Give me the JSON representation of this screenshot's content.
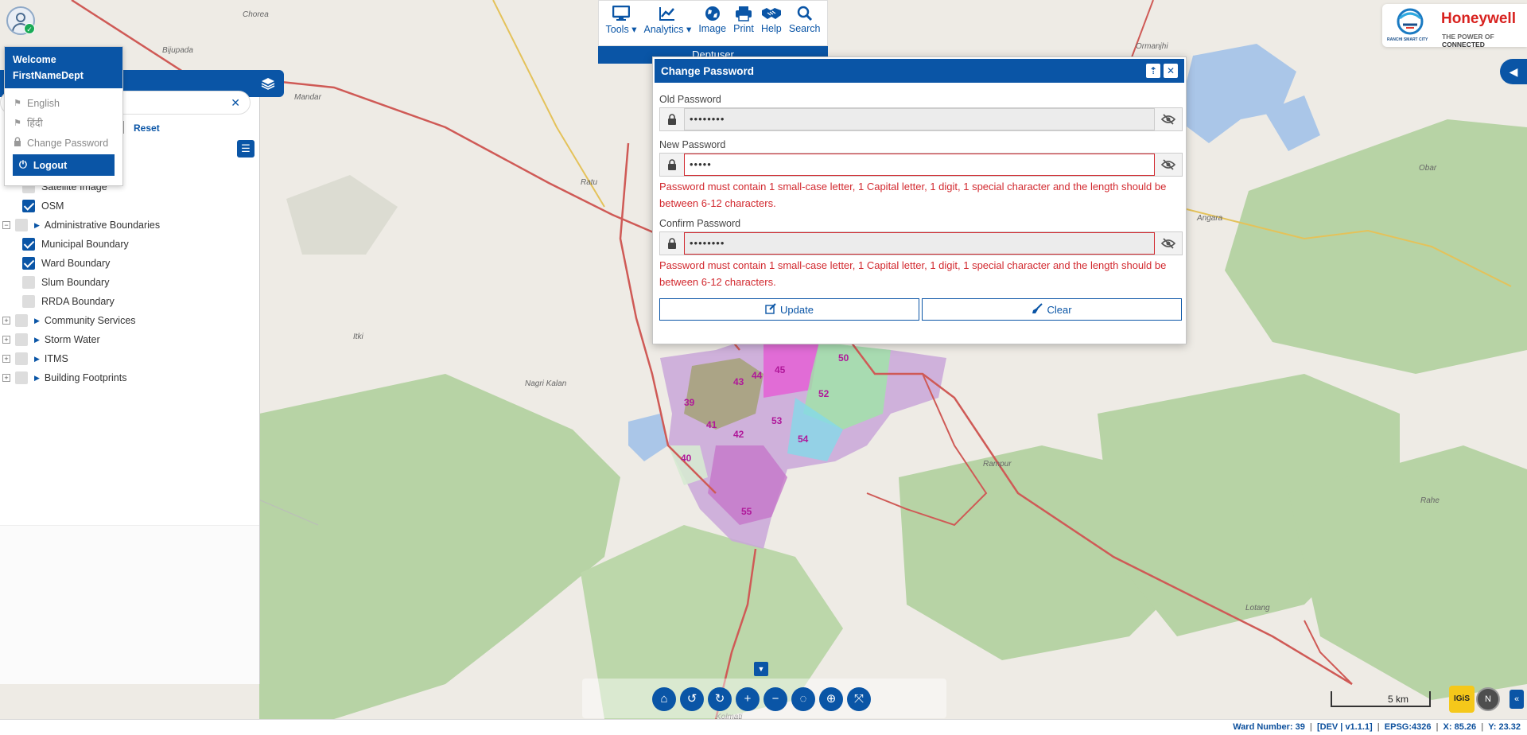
{
  "user": {
    "welcome": "Welcome",
    "name": "FirstNameDept",
    "menu": [
      {
        "label": "English",
        "icon": "flag-icon"
      },
      {
        "label": "हिंदी",
        "icon": "flag-icon"
      },
      {
        "label": "Change Password",
        "icon": "lock-icon"
      }
    ],
    "logout": "Logout"
  },
  "toolbar": {
    "items": [
      {
        "label": "Tools",
        "icon": "monitor-icon",
        "dropdown": true
      },
      {
        "label": "Analytics",
        "icon": "chart-line-icon",
        "dropdown": true
      },
      {
        "label": "Image",
        "icon": "globe-icon"
      },
      {
        "label": "Print",
        "icon": "print-icon"
      },
      {
        "label": "Help",
        "icon": "handshake-icon"
      },
      {
        "label": "Search",
        "icon": "search-icon"
      }
    ],
    "user_bar": "Deptuser"
  },
  "layer_panel": {
    "reset": "Reset",
    "layers": [
      {
        "label": "Satellite Image",
        "checked": false,
        "level": 1
      },
      {
        "label": "OSM",
        "checked": true,
        "level": 1
      },
      {
        "label": "Administrative Boundaries",
        "checked": false,
        "level": 0,
        "group": true
      },
      {
        "label": "Municipal Boundary",
        "checked": true,
        "level": 1
      },
      {
        "label": "Ward Boundary",
        "checked": true,
        "level": 1
      },
      {
        "label": "Slum Boundary",
        "checked": false,
        "level": 1
      },
      {
        "label": "RRDA Boundary",
        "checked": false,
        "level": 1
      },
      {
        "label": "Community Services",
        "checked": false,
        "level": 0,
        "group": true
      },
      {
        "label": "Storm Water",
        "checked": false,
        "level": 0,
        "group": true
      },
      {
        "label": "ITMS",
        "checked": false,
        "level": 0,
        "group": true
      },
      {
        "label": "Building Footprints",
        "checked": false,
        "level": 0,
        "group": true
      }
    ]
  },
  "dialog": {
    "title": "Change Password",
    "old_label": "Old Password",
    "old_value": "••••••••",
    "new_label": "New Password",
    "new_value": "•••••",
    "new_error": "Password must contain 1 small-case letter, 1 Capital letter, 1 digit, 1 special character and the length should be between 6-12 characters.",
    "confirm_label": "Confirm Password",
    "confirm_value": "••••••••",
    "confirm_error": "Password must contain 1 small-case letter, 1 Capital letter, 1 digit, 1 special character and the length should be between 6-12 characters.",
    "update": "Update",
    "clear": "Clear"
  },
  "branding": {
    "company": "Honeywell",
    "tagline_prefix": "THE POWER OF",
    "tagline_bold": "CONNECTED",
    "city_logo_text": "RANCHI SMART CITY"
  },
  "map": {
    "places": [
      "Chorea",
      "Bijupada",
      "Mandar",
      "Ratu",
      "Itki",
      "Nagri Kalan",
      "Ormanjhi",
      "Obar",
      "Angara",
      "Rampur",
      "Rahe",
      "Lotang",
      "Kolmati"
    ],
    "wards": [
      "39",
      "40",
      "41",
      "42",
      "43",
      "44",
      "45",
      "50",
      "52",
      "53",
      "54",
      "55"
    ],
    "scale": "5 km",
    "igis": "IGiS",
    "north": "N"
  },
  "status": {
    "ward": "Ward Number: 39",
    "version": "[DEV | v1.1.1]",
    "epsg": "EPSG:4326",
    "x": "X: 85.26",
    "y": "Y: 23.32"
  },
  "colors": {
    "primary": "#0a55a6",
    "error": "#d2292f",
    "brand_red": "#d8221f"
  }
}
